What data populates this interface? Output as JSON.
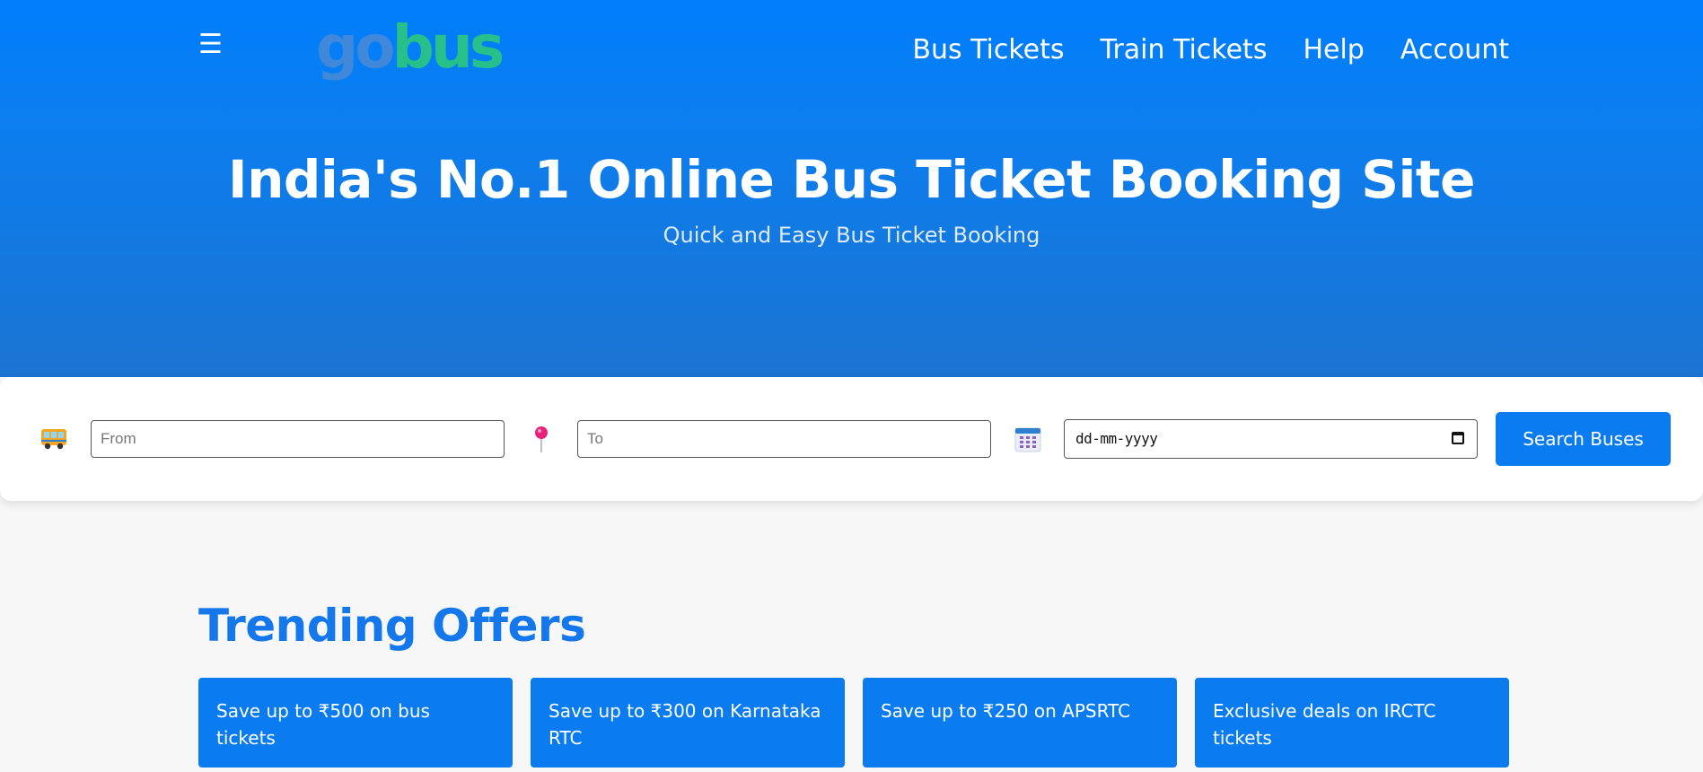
{
  "header": {
    "logo": {
      "part1": "go",
      "part2": "bus"
    },
    "nav": [
      "Bus Tickets",
      "Train Tickets",
      "Help",
      "Account"
    ],
    "menu_icon": "hamburger-menu-icon"
  },
  "hero": {
    "title": "India's No.1 Online Bus Ticket Booking Site",
    "subtitle": "Quick and Easy Bus Ticket Booking"
  },
  "search": {
    "from_placeholder": "From",
    "to_placeholder": "To",
    "date_placeholder": "dd-mm-yyyy",
    "button_label": "Search Buses",
    "icons": [
      "bus-icon",
      "location-pin-icon",
      "calendar-icon"
    ]
  },
  "offers": {
    "title": "Trending Offers",
    "items": [
      "Save up to ₹500 on bus tickets",
      "Save up to ₹300 on Karnataka RTC",
      "Save up to ₹250 on APSRTC",
      "Exclusive deals on IRCTC tickets"
    ]
  },
  "colors": {
    "primary": "#007efc",
    "header_bottom": "#1b74d2",
    "accent_green": "#27c08a",
    "title_blue": "#1478ec",
    "background": "#f7f7f7"
  }
}
